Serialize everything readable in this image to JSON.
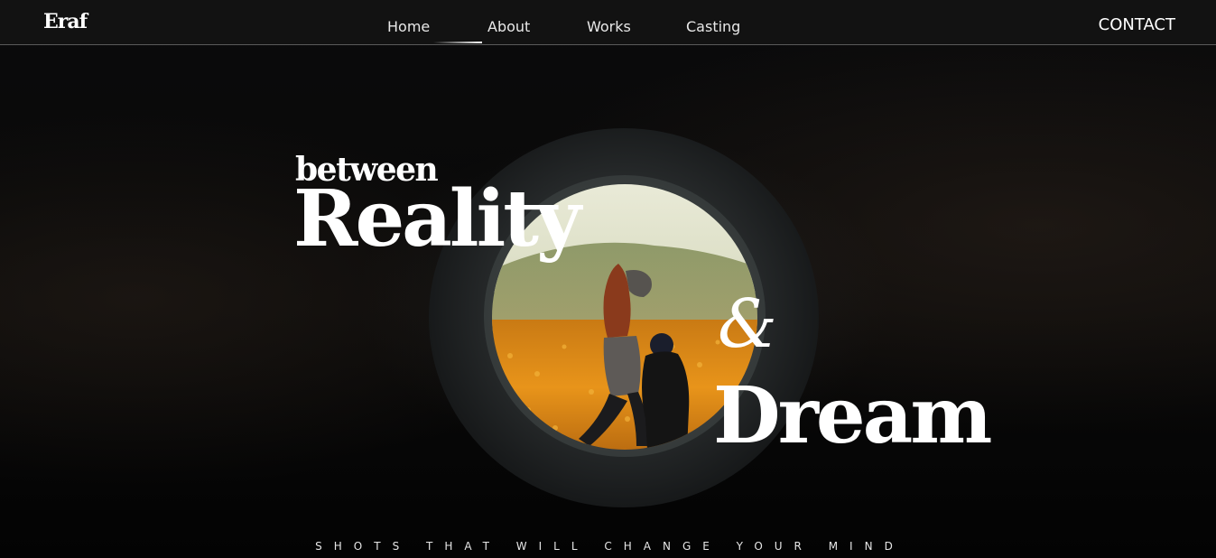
{
  "nav": {
    "logo": "Eraf",
    "links": [
      "Home",
      "About",
      "Works",
      "Casting"
    ],
    "active": "Home",
    "contact": "CONTACT"
  },
  "hero": {
    "word_1": "between",
    "word_2": "Reality",
    "word_3": "&",
    "word_4": "Dream",
    "tagline": "SHOTS THAT WILL CHANGE YOUR MIND"
  },
  "icons": {
    "hero_photo": "photo-of-two-people-sitting-in-round-concrete-opening-over-flower-field"
  },
  "colors": {
    "background": "#050505",
    "navbar": "#121212",
    "text": "#ffffff",
    "field": "#e8941a"
  }
}
